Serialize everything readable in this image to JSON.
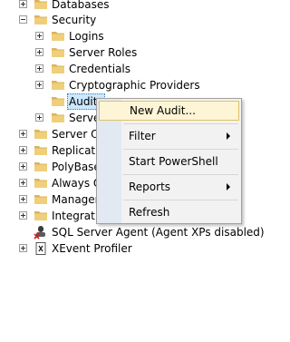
{
  "tree": {
    "databases": "Databases",
    "security": "Security",
    "logins": "Logins",
    "server_roles": "Server Roles",
    "credentials": "Credentials",
    "crypto_providers": "Cryptographic Providers",
    "audits": "Audits",
    "server_audit_specs": "Server Audit Specifications",
    "server_objects": "Server Objects",
    "replication": "Replication",
    "polybase": "PolyBase",
    "always_on": "Always On High Availability",
    "management": "Management",
    "integration": "Integration Services Catalogs",
    "sql_agent": "SQL Server Agent (Agent XPs disabled)",
    "xevent": "XEvent Profiler"
  },
  "context_menu": {
    "new_audit": "New Audit...",
    "filter": "Filter",
    "start_powershell": "Start PowerShell",
    "reports": "Reports",
    "refresh": "Refresh"
  },
  "colors": {
    "folder": "#dcb35c",
    "selection": "#cce8ff",
    "highlight": "#fdf5d5",
    "gutter": "#e3e9f3"
  }
}
